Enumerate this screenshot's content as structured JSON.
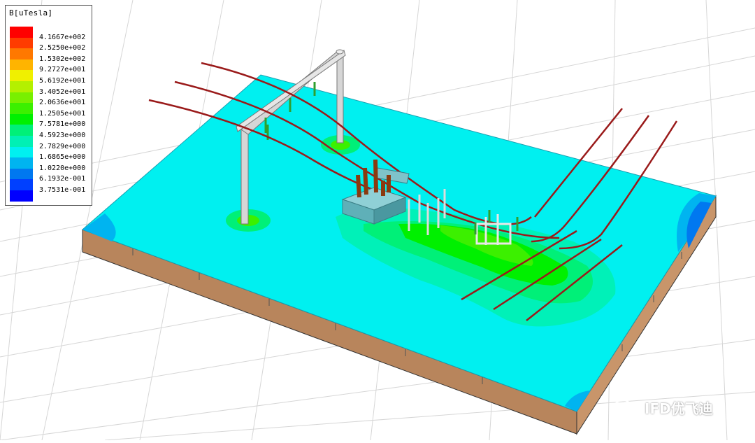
{
  "legend": {
    "title": "B[uTesla]",
    "entries": [
      {
        "label": "4.1667e+002",
        "color": "#ff0000"
      },
      {
        "label": "2.5250e+002",
        "color": "#ff3c00"
      },
      {
        "label": "1.5302e+002",
        "color": "#ff7800"
      },
      {
        "label": "9.2727e+001",
        "color": "#ffb400"
      },
      {
        "label": "5.6192e+001",
        "color": "#f0f000"
      },
      {
        "label": "3.4052e+001",
        "color": "#b4f000"
      },
      {
        "label": "2.0636e+001",
        "color": "#78f000"
      },
      {
        "label": "1.2505e+001",
        "color": "#3cf000"
      },
      {
        "label": "7.5781e+000",
        "color": "#00f000"
      },
      {
        "label": "4.5923e+000",
        "color": "#00f078"
      },
      {
        "label": "2.7829e+000",
        "color": "#00f0b4"
      },
      {
        "label": "1.6865e+000",
        "color": "#00f0f0"
      },
      {
        "label": "1.0220e+000",
        "color": "#00b4f0"
      },
      {
        "label": "6.1932e-001",
        "color": "#0078f0"
      },
      {
        "label": "3.7531e-001",
        "color": "#0040ff"
      },
      {
        "label": "",
        "color": "#0000ff"
      }
    ]
  },
  "scene": {
    "ground_color": "#00f0f0",
    "base_color": "#c8956a",
    "conductor_color": "#9a1a1a",
    "tower_color": "#d8d8d8",
    "transformer_color": "#5fb0b8"
  },
  "watermark": {
    "text": "IFD优飞迪"
  }
}
